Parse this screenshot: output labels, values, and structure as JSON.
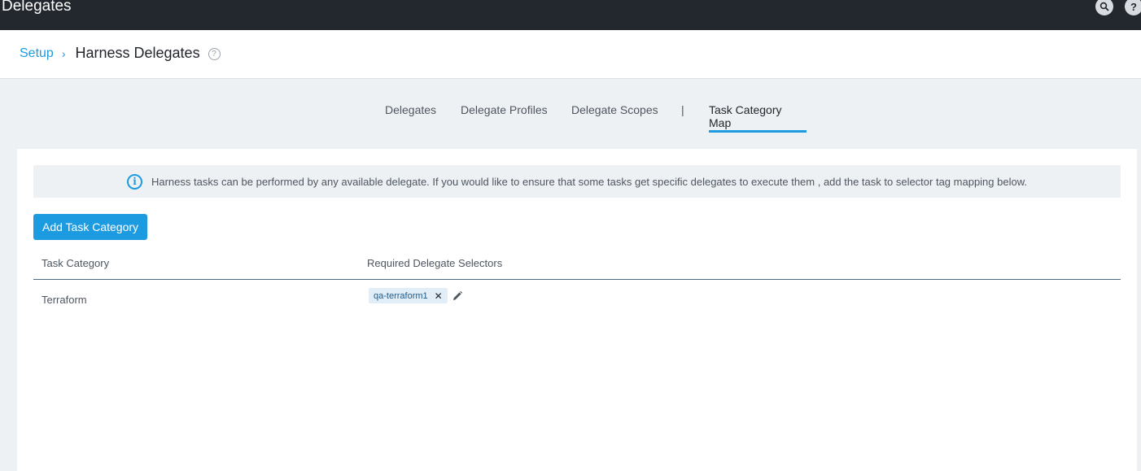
{
  "topbar": {
    "title": "Delegates",
    "search_icon": "search-icon",
    "help_label": "?"
  },
  "header": {
    "breadcrumb": {
      "root": "Setup",
      "separator": "›"
    },
    "title": "Harness Delegates",
    "help_glyph": "?"
  },
  "tabs": [
    {
      "label": "Delegates",
      "active": false
    },
    {
      "label": "Delegate Profiles",
      "active": false
    },
    {
      "label": "Delegate Scopes",
      "active": false
    },
    {
      "label": "Task Category Map",
      "active": true
    }
  ],
  "tab_divider": "|",
  "banner": {
    "icon": "info-icon",
    "glyph": "i",
    "text": "Harness tasks can be performed by any available delegate. If you would like to ensure that some tasks get specific delegates to execute them , add the task to selector tag mapping below."
  },
  "actions": {
    "add_label": "Add Task Category"
  },
  "table": {
    "columns": [
      "Task Category",
      "Required Delegate Selectors"
    ],
    "rows": [
      {
        "category": "Terraform",
        "selectors": [
          "qa-terraform1"
        ]
      }
    ]
  },
  "colors": {
    "accent": "#1d9be0",
    "topbar": "#23272e",
    "tag_bg": "#e1eef8"
  }
}
